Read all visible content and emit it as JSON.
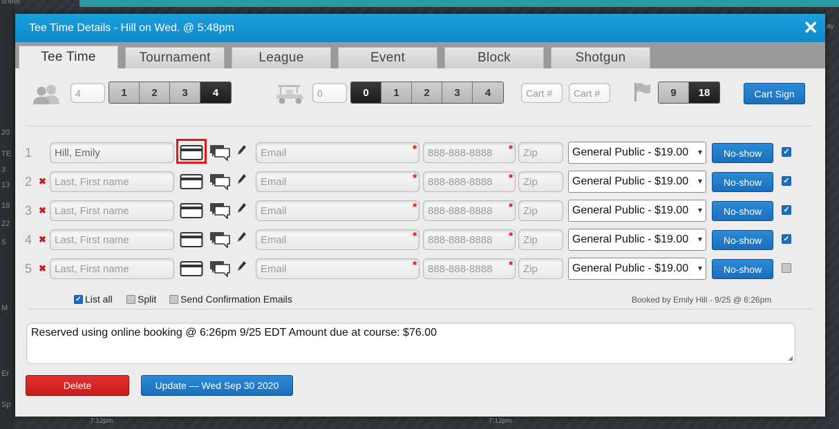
{
  "background": {
    "left_labels": [
      "sheet",
      "20",
      "TE",
      "3",
      "13",
      "18",
      "22",
      "5",
      "Sp",
      "M",
      "Er"
    ],
    "top_right_label": "ay",
    "bottom_labels": [
      "7:12pm",
      "7:12pm"
    ]
  },
  "modal": {
    "title": "Tee Time Details - Hill on Wed. @ 5:48pm",
    "close_glyph": "✕",
    "tabs": [
      {
        "label": "Tee Time",
        "active": true
      },
      {
        "label": "Tournament",
        "active": false
      },
      {
        "label": "League",
        "active": false
      },
      {
        "label": "Event",
        "active": false
      },
      {
        "label": "Block",
        "active": false
      },
      {
        "label": "Shotgun",
        "active": false
      }
    ]
  },
  "players_control": {
    "icon": "people-icon",
    "count_value": "4",
    "options": [
      "1",
      "2",
      "3",
      "4"
    ],
    "selected": "4"
  },
  "carts_control": {
    "icon": "golf-cart-icon",
    "count_value": "0",
    "options": [
      "0",
      "1",
      "2",
      "3",
      "4"
    ],
    "selected": "0",
    "cart_placeholders": [
      "Cart #",
      "Cart #"
    ]
  },
  "holes_control": {
    "icon": "flag-icon",
    "options": [
      "9",
      "18"
    ],
    "selected": "18"
  },
  "cart_sign_label": "Cart Sign",
  "players": [
    {
      "num": "1",
      "removable": false,
      "name": "Hill, Emily",
      "name_placeholder": "Last, First name",
      "email_placeholder": "Email",
      "phone_placeholder": "888-888-8888",
      "zip_placeholder": "Zip",
      "rate": "General Public - $19.00",
      "noshow_label": "No-show",
      "checked": true,
      "card_highlighted": true
    },
    {
      "num": "2",
      "removable": true,
      "name": "",
      "name_placeholder": "Last, First name",
      "email_placeholder": "Email",
      "phone_placeholder": "888-888-8888",
      "zip_placeholder": "Zip",
      "rate": "General Public - $19.00",
      "noshow_label": "No-show",
      "checked": true,
      "card_highlighted": false
    },
    {
      "num": "3",
      "removable": true,
      "name": "",
      "name_placeholder": "Last, First name",
      "email_placeholder": "Email",
      "phone_placeholder": "888-888-8888",
      "zip_placeholder": "Zip",
      "rate": "General Public - $19.00",
      "noshow_label": "No-show",
      "checked": true,
      "card_highlighted": false
    },
    {
      "num": "4",
      "removable": true,
      "name": "",
      "name_placeholder": "Last, First name",
      "email_placeholder": "Email",
      "phone_placeholder": "888-888-8888",
      "zip_placeholder": "Zip",
      "rate": "General Public - $19.00",
      "noshow_label": "No-show",
      "checked": true,
      "card_highlighted": false
    },
    {
      "num": "5",
      "removable": true,
      "name": "",
      "name_placeholder": "Last, First name",
      "email_placeholder": "Email",
      "phone_placeholder": "888-888-8888",
      "zip_placeholder": "Zip",
      "rate": "General Public - $19.00",
      "noshow_label": "No-show",
      "checked": false,
      "card_highlighted": false
    }
  ],
  "options": {
    "list_all": {
      "label": "List all",
      "checked": true
    },
    "split": {
      "label": "Split",
      "checked": false
    },
    "send_emails": {
      "label": "Send Confirmation Emails",
      "checked": false
    }
  },
  "booked_by": "Booked by Emily Hill - 9/25 @ 6:26pm",
  "notes": "Reserved using online booking @ 6:26pm 9/25 EDT Amount due at course: $76.00",
  "actions": {
    "delete_label": "Delete",
    "update_label": "Update — Wed Sep 30 2020"
  },
  "colors": {
    "header_blue": "#1aa0dc",
    "button_blue": "#1a6fbd",
    "delete_red": "#d42424",
    "highlight_red": "#e01919",
    "required_red": "#e01010"
  }
}
